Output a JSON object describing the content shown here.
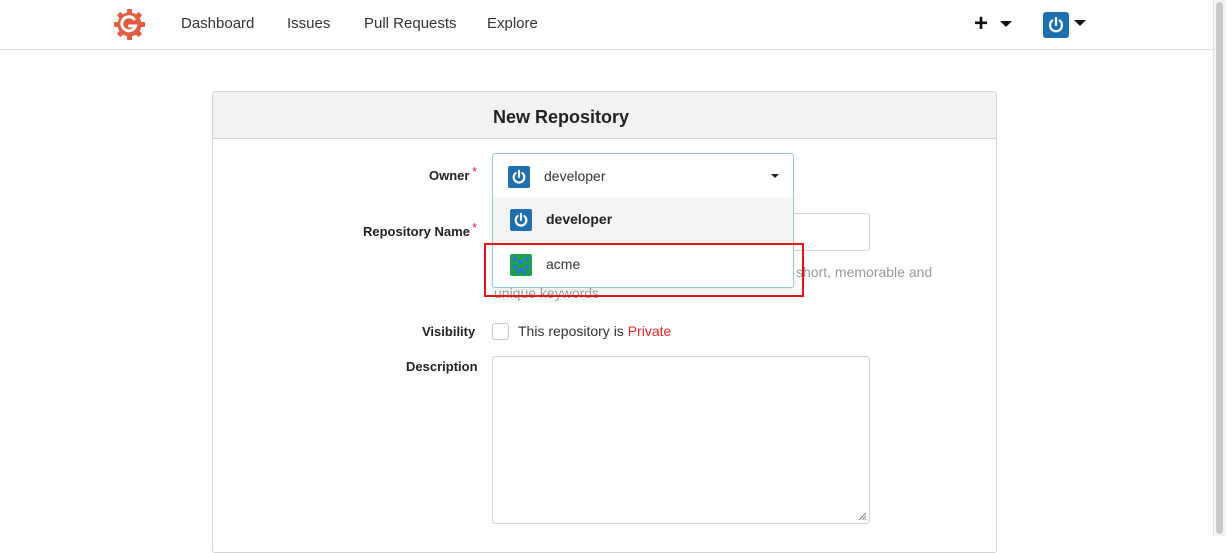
{
  "nav": {
    "items": [
      {
        "label": "Dashboard"
      },
      {
        "label": "Issues"
      },
      {
        "label": "Pull Requests"
      },
      {
        "label": "Explore"
      }
    ],
    "create_icon": "plus-icon",
    "user_avatar_icon": "power-icon"
  },
  "form": {
    "title": "New Repository",
    "owner": {
      "label": "Owner",
      "required_mark": "*",
      "selected": "developer",
      "options": [
        {
          "label": "developer",
          "avatar": "power-icon"
        },
        {
          "label": "acme",
          "avatar": "identicon"
        }
      ]
    },
    "repo_name": {
      "label": "Repository Name",
      "required_mark": "*",
      "value": "",
      "help_visible": "short, memorable and",
      "help_obscured": "unique keywords"
    },
    "visibility": {
      "label": "Visibility",
      "text": "This repository is",
      "private_word": "Private",
      "checked": false
    },
    "description": {
      "label": "Description",
      "value": ""
    }
  },
  "colors": {
    "brand": "#e05d44",
    "avatar_blue": "#1f6fb0",
    "required": "#db2828",
    "highlight": "#e0161a"
  }
}
